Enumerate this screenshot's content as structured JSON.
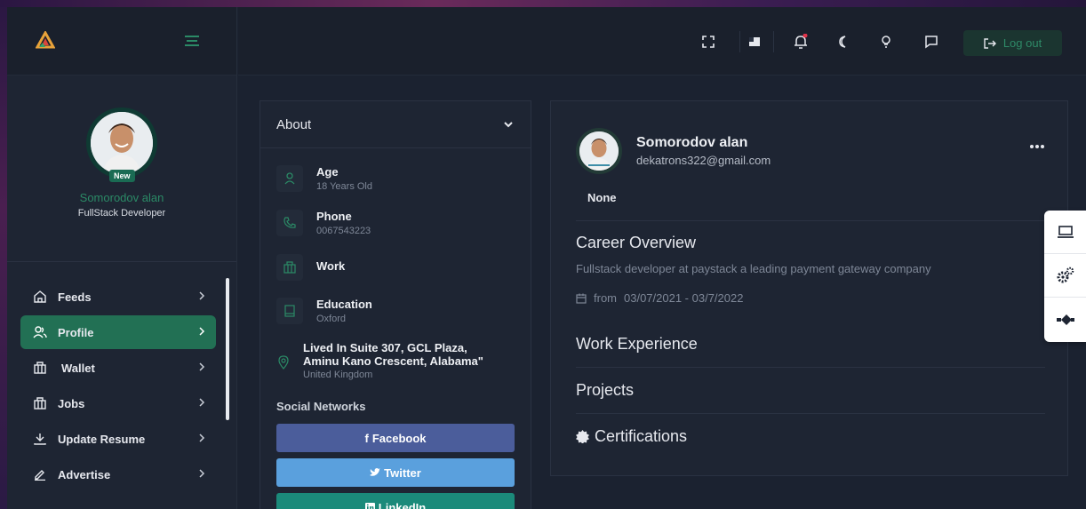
{
  "sidebar": {
    "profile": {
      "badge": "New",
      "name": "Somorodov alan",
      "role": "FullStack Developer"
    },
    "items": [
      {
        "label": "Feeds",
        "icon": "home-icon"
      },
      {
        "label": "Profile",
        "icon": "users-icon"
      },
      {
        "label": "Wallet",
        "icon": "wallet-icon"
      },
      {
        "label": "Jobs",
        "icon": "briefcase-icon"
      },
      {
        "label": "Update Resume",
        "icon": "download-icon"
      },
      {
        "label": "Advertise",
        "icon": "pen-icon"
      }
    ]
  },
  "header": {
    "logout_label": "Log out"
  },
  "about": {
    "title": "About",
    "age": {
      "label": "Age",
      "value": "18 Years Old"
    },
    "phone": {
      "label": "Phone",
      "value": "0067543223"
    },
    "work": {
      "label": "Work"
    },
    "education": {
      "label": "Education",
      "value": "Oxford"
    },
    "address": {
      "line1": "Lived In Suite 307, GCL Plaza,",
      "line2": "Aminu Kano Crescent, Alabama\"",
      "country": "United Kingdom"
    },
    "social_title": "Social Networks",
    "facebook": "Facebook",
    "twitter": "Twitter",
    "linkedin": "LinkedIn"
  },
  "profile": {
    "name": "Somorodov alan",
    "email": "dekatrons322@gmail.com",
    "status": "None",
    "career_title": "Career Overview",
    "career_desc": "Fullstack developer at paystack a leading payment gateway company",
    "career_from": "from",
    "career_range": "03/07/2021 - 03/7/2022",
    "work_title": "Work Experience",
    "projects_title": "Projects",
    "cert_title": "Certifications"
  },
  "colors": {
    "accent": "#227054",
    "brand_green": "#2b8a66",
    "facebook": "#4b5d9b",
    "twitter": "#5aa0dd",
    "linkedin": "#1b8a7a"
  }
}
